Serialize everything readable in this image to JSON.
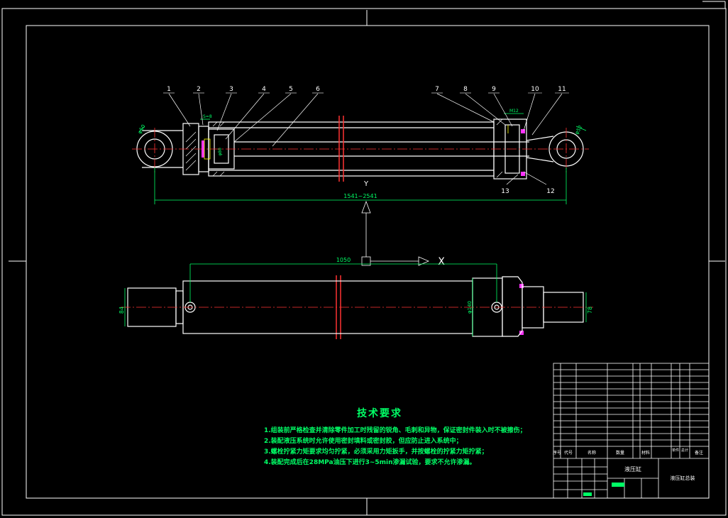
{
  "drawing": {
    "part_labels": [
      "1",
      "2",
      "3",
      "4",
      "5",
      "6",
      "7",
      "8",
      "9",
      "10",
      "11",
      "12",
      "13"
    ],
    "dimensions": {
      "overall_length": "1541~2541",
      "stroke": "1050",
      "left_pin": "φ50",
      "right_pin": "φ52",
      "bore": "φ140",
      "rod": "φ80",
      "left_end": "84",
      "right_end": "78",
      "bolt_size": "M12",
      "small_gap": "S=8"
    },
    "view_markers": {
      "view_letter": "X",
      "section_letter": "Y"
    }
  },
  "tech_requirements": {
    "title": "技术要求",
    "items": [
      "1.组装前严格检查并清除零件加工时残留的锐角、毛刺和异物，保证密封件装入时不被擦伤；",
      "2.装配液压系统时允许使用密封填料或密封胶，但应防止进入系统中；",
      "3.螺栓拧紧力矩要求均匀拧紧，必须采用力矩扳手，并按螺栓的拧紧力矩拧紧；",
      "4.装配完成后在28MPa油压下进行3~5min渗漏试验，要求不允许渗漏。"
    ]
  },
  "title_block": {
    "col_headers": [
      "序号",
      "代号",
      "名称",
      "数量",
      "材料",
      "单件",
      "总计",
      "备注"
    ],
    "drawing_title": "液压缸",
    "drawing_name": "液压缸总装"
  },
  "colors": {
    "background": "#000000",
    "outline": "#ffffff",
    "dimension": "#00ff66",
    "centerline": "#ff3333",
    "leader": "#ffffff",
    "highlight": "#ff33ff",
    "accent": "#ffff00"
  }
}
